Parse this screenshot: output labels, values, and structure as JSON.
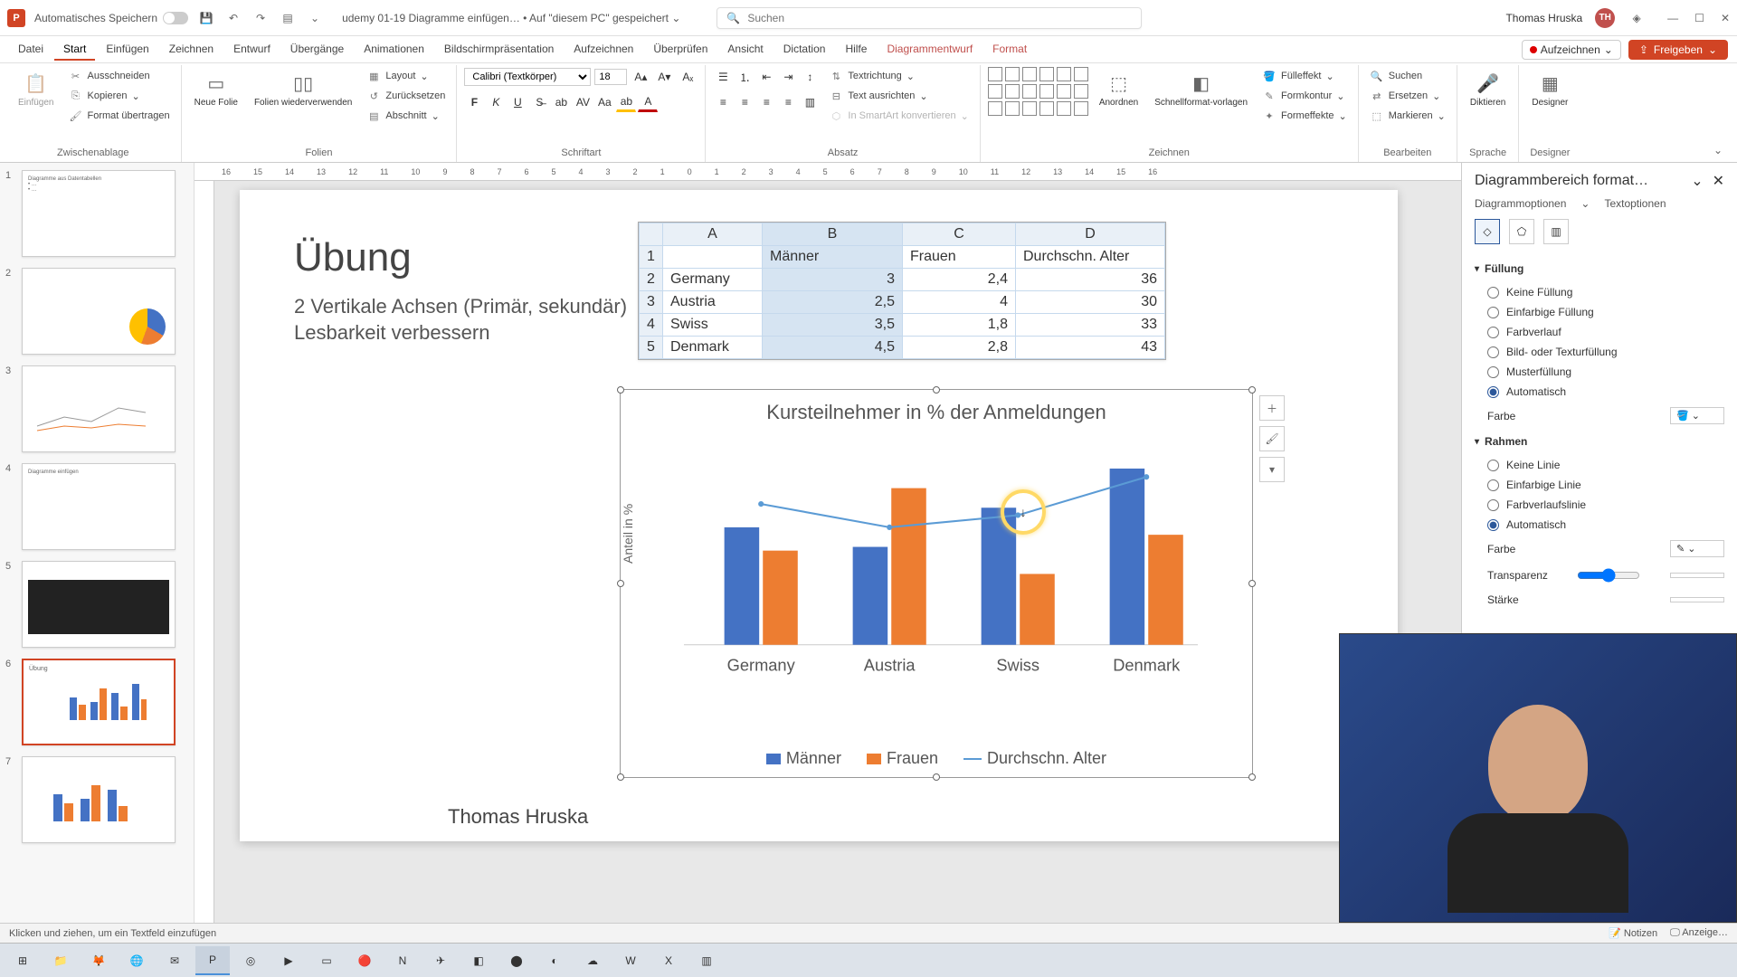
{
  "titlebar": {
    "autosave_label": "Automatisches Speichern",
    "doc_title": "udemy 01-19 Diagramme einfügen… • Auf \"diesem PC\" gespeichert ⌄",
    "search_placeholder": "Suchen",
    "user_name": "Thomas Hruska",
    "user_initials": "TH"
  },
  "menubar": {
    "tabs": [
      "Datei",
      "Start",
      "Einfügen",
      "Zeichnen",
      "Entwurf",
      "Übergänge",
      "Animationen",
      "Bildschirmpräsentation",
      "Aufzeichnen",
      "Überprüfen",
      "Ansicht",
      "Dictation",
      "Hilfe",
      "Diagrammentwurf",
      "Format"
    ],
    "active_index": 1,
    "record_label": "Aufzeichnen",
    "share_label": "Freigeben"
  },
  "ribbon": {
    "clipboard": {
      "paste": "Einfügen",
      "cut": "Ausschneiden",
      "copy": "Kopieren",
      "format_painter": "Format übertragen",
      "group": "Zwischenablage"
    },
    "slides": {
      "new_slide": "Neue Folie",
      "reuse": "Folien wiederverwenden",
      "layout": "Layout",
      "reset": "Zurücksetzen",
      "section": "Abschnitt",
      "group": "Folien"
    },
    "font": {
      "name": "Calibri (Textkörper)",
      "size": "18",
      "group": "Schriftart"
    },
    "paragraph": {
      "text_direction": "Textrichtung",
      "align_text": "Text ausrichten",
      "smartart": "In SmartArt konvertieren",
      "group": "Absatz"
    },
    "drawing": {
      "arrange": "Anordnen",
      "quick_styles": "Schnellformat-vorlagen",
      "shape_fill": "Fülleffekt",
      "shape_outline": "Formkontur",
      "shape_effects": "Formeffekte",
      "group": "Zeichnen"
    },
    "editing": {
      "find": "Suchen",
      "replace": "Ersetzen",
      "select": "Markieren",
      "group": "Bearbeiten"
    },
    "voice": {
      "dictate": "Diktieren",
      "group": "Sprache"
    },
    "designer": {
      "btn": "Designer",
      "group": "Designer"
    }
  },
  "slide": {
    "title": "Übung",
    "subtitle1": "2 Vertikale Achsen (Primär, sekundär)",
    "subtitle2": "Lesbarkeit verbessern",
    "author": "Thomas Hruska"
  },
  "data_table": {
    "col_letters": [
      "A",
      "B",
      "C",
      "D"
    ],
    "headers": [
      "",
      "Männer",
      "Frauen",
      "Durchschn. Alter"
    ],
    "rows": [
      {
        "n": "2",
        "label": "Germany",
        "b": "3",
        "c": "2,4",
        "d": "36"
      },
      {
        "n": "3",
        "label": "Austria",
        "b": "2,5",
        "c": "4",
        "d": "30"
      },
      {
        "n": "4",
        "label": "Swiss",
        "b": "3,5",
        "c": "1,8",
        "d": "33"
      },
      {
        "n": "5",
        "label": "Denmark",
        "b": "4,5",
        "c": "2,8",
        "d": "43"
      }
    ]
  },
  "chart_data": {
    "type": "bar",
    "title": "Kursteilnehmer in % der Anmeldungen",
    "ylabel": "Anteil in %",
    "categories": [
      "Germany",
      "Austria",
      "Swiss",
      "Denmark"
    ],
    "series": [
      {
        "name": "Männer",
        "type": "bar",
        "values": [
          3,
          2.5,
          3.5,
          4.5
        ],
        "color": "#4472c4",
        "axis": "primary"
      },
      {
        "name": "Frauen",
        "type": "bar",
        "values": [
          2.4,
          4,
          1.8,
          2.8
        ],
        "color": "#ed7d31",
        "axis": "primary"
      },
      {
        "name": "Durchschn. Alter",
        "type": "line",
        "values": [
          36,
          30,
          33,
          43
        ],
        "color": "#5b9bd5",
        "axis": "secondary"
      }
    ],
    "ylim_primary": [
      0,
      5
    ],
    "ylim_secondary": [
      0,
      50
    ],
    "yticks_primary": [
      0,
      1,
      2,
      3,
      4,
      5
    ],
    "yticks_secondary": [
      0,
      10,
      20,
      30,
      40,
      50
    ],
    "legend_items": [
      "Männer",
      "Frauen",
      "Durchschn. Alter"
    ]
  },
  "format_pane": {
    "title": "Diagrammbereich format…",
    "sub_tabs": [
      "Diagrammoptionen",
      "Textoptionen"
    ],
    "fill_header": "Füllung",
    "fill_options": [
      "Keine Füllung",
      "Einfarbige Füllung",
      "Farbverlauf",
      "Bild- oder Texturfüllung",
      "Musterfüllung",
      "Automatisch"
    ],
    "fill_selected": 5,
    "color_label": "Farbe",
    "border_header": "Rahmen",
    "border_options": [
      "Keine Linie",
      "Einfarbige Linie",
      "Farbverlaufslinie",
      "Automatisch"
    ],
    "border_selected": 3,
    "transparency_label": "Transparenz",
    "width_label": "Stärke"
  },
  "statusbar": {
    "left": "Klicken und ziehen, um ein Textfeld einzufügen",
    "notes": "Notizen",
    "display": "Anzeige…"
  },
  "thumbs": {
    "count": 7,
    "active": 6
  }
}
